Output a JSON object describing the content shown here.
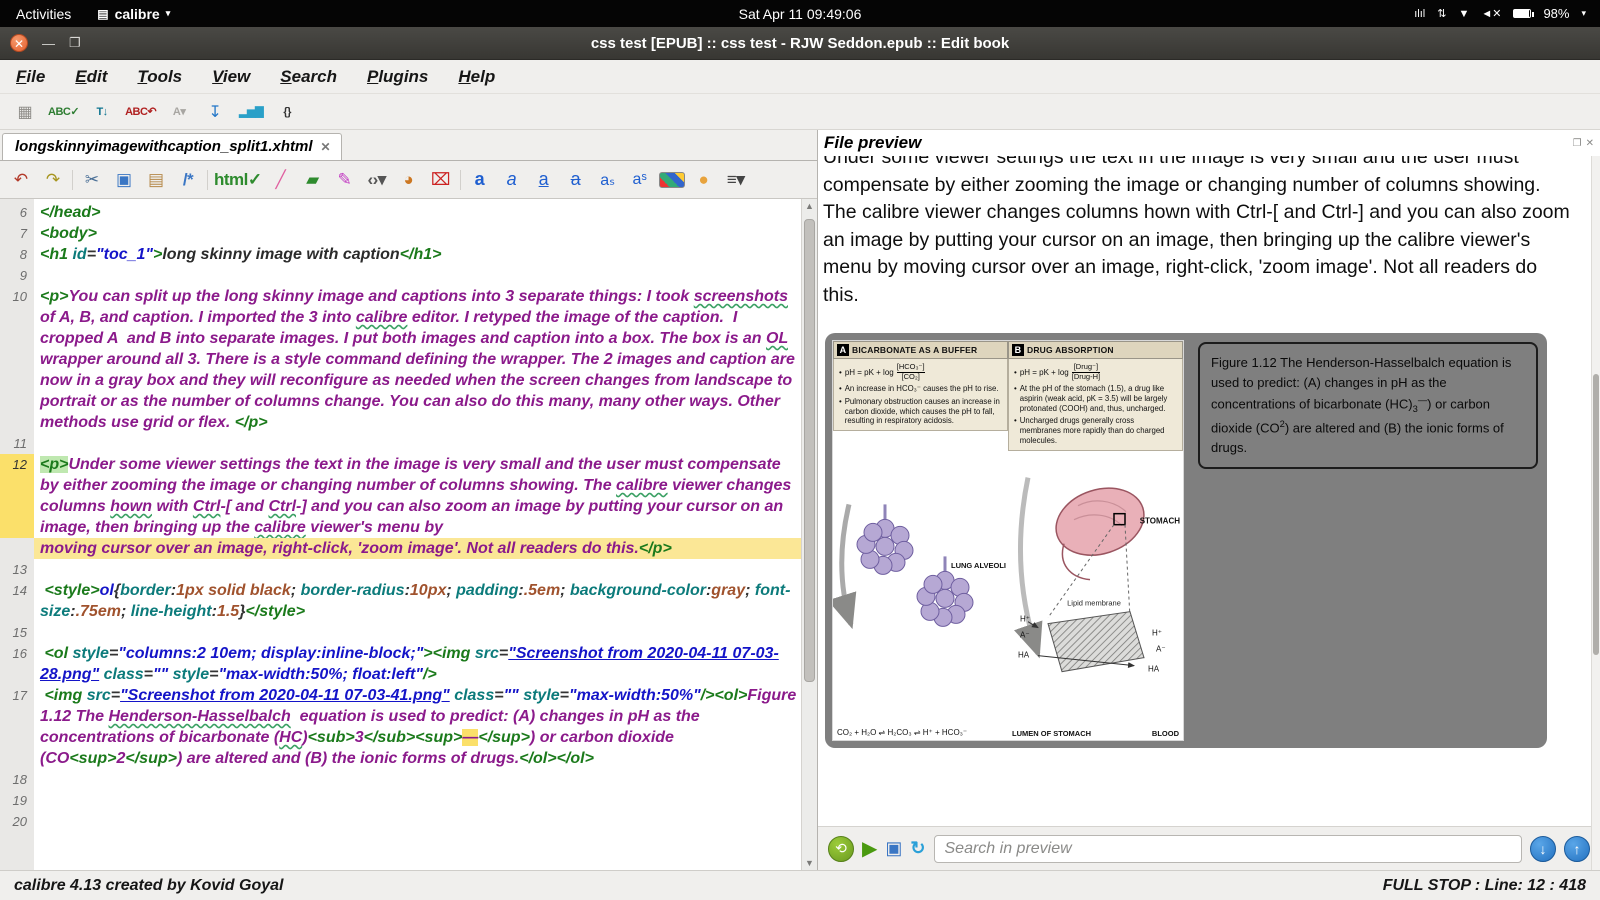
{
  "top_bar": {
    "activities": "Activities",
    "app_name": "calibre",
    "clock": "Sat Apr 11 09:49:06",
    "battery_pct": "98%",
    "tray": [
      {
        "name": "system-monitor-icon",
        "glyph": "ılıl"
      },
      {
        "name": "input-source-icon",
        "glyph": "⇅"
      },
      {
        "name": "network-icon",
        "glyph": "▼"
      },
      {
        "name": "volume-muted-icon",
        "glyph": "◄✕"
      }
    ]
  },
  "window": {
    "title": "css test [EPUB] :: css test - RJW Seddon.epub :: Edit book"
  },
  "menus": [
    "File",
    "Edit",
    "Tools",
    "View",
    "Search",
    "Plugins",
    "Help"
  ],
  "main_toolbar": [
    {
      "name": "grid-icon",
      "glyph": "▦",
      "color": "#8f8d89"
    },
    {
      "name": "spellcheck-icon",
      "glyph": "ABC✓",
      "txt": true,
      "color": "#2e7d32"
    },
    {
      "name": "text-down-arrow-icon",
      "glyph": "T↓",
      "txt": true,
      "color": "#0e7490"
    },
    {
      "name": "text-replace-icon",
      "glyph": "ABC↶",
      "txt": true,
      "color": "#b02020"
    },
    {
      "name": "letter-a-menu-icon",
      "glyph": "A▾",
      "txt": true,
      "color": "#a8a6a2"
    },
    {
      "name": "download-arrow-icon",
      "glyph": "↧",
      "color": "#2477c8"
    },
    {
      "name": "bar-chart-icon",
      "glyph": "▂▅▇",
      "txt": true,
      "color": "#2aa0c8"
    },
    {
      "name": "braces-icon",
      "glyph": "{}",
      "txt": true,
      "color": "#333333"
    }
  ],
  "editor": {
    "tab": {
      "label": "longskinnyimagewithcaption_split1.xhtml",
      "close_glyph": "✕"
    },
    "toolbar": [
      {
        "name": "undo-icon",
        "glyph": "↶",
        "color": "#b33a2a"
      },
      {
        "name": "redo-icon",
        "glyph": "↷",
        "color": "#a7951f"
      },
      {
        "sep": true
      },
      {
        "name": "cut-icon",
        "glyph": "✂",
        "color": "#4a6f96"
      },
      {
        "name": "copy-icon",
        "glyph": "▣",
        "color": "#3a76c4"
      },
      {
        "name": "paste-icon",
        "glyph": "▤",
        "color": "#b5894a"
      },
      {
        "name": "comment-icon",
        "glyph": "/*",
        "txt": true,
        "color": "#3a76c4"
      },
      {
        "sep": true
      },
      {
        "name": "html-check-icon",
        "glyph": "html✓",
        "txt": true,
        "color": "#2e8b2e"
      },
      {
        "name": "pink-slash-icon",
        "glyph": "╱",
        "color": "#e060a0"
      },
      {
        "name": "green-book-icon",
        "glyph": "▰",
        "color": "#2e8b2e"
      },
      {
        "name": "beautify-pen-icon",
        "glyph": "✎",
        "color": "#c23ac2"
      },
      {
        "name": "code-tags-icon",
        "glyph": "‹›▾",
        "txt": true,
        "color": "#555555"
      },
      {
        "name": "color-wheel-icon",
        "glyph": "◕",
        "color": "#cc7722"
      },
      {
        "name": "trash-icon",
        "glyph": "⌧",
        "color": "#cc2222"
      },
      {
        "sep": true
      },
      {
        "name": "bold-a-icon",
        "glyph": "a",
        "cls": "ab"
      },
      {
        "name": "italic-a-icon",
        "glyph": "a",
        "cls": "ai"
      },
      {
        "name": "underline-a-icon",
        "glyph": "a",
        "cls": "au"
      },
      {
        "name": "strikethrough-a-icon",
        "glyph": "a",
        "cls": "as"
      },
      {
        "name": "subscript-icon",
        "glyph": "aₛ",
        "cls": "asub"
      },
      {
        "name": "superscript-icon",
        "glyph": "aˢ",
        "cls": "asup"
      },
      {
        "name": "text-color-icon",
        "swatch": true
      },
      {
        "name": "background-color-icon",
        "glyph": "●",
        "color": "#e8a33d"
      },
      {
        "name": "align-menu-icon",
        "glyph": "≡▾",
        "txt": true,
        "color": "#444444"
      }
    ],
    "lines": [
      {
        "num": "6",
        "seg": [
          {
            "t": "</head>",
            "c": "g"
          }
        ]
      },
      {
        "num": "7",
        "seg": [
          {
            "t": "<body>",
            "c": "g"
          }
        ]
      },
      {
        "num": "8",
        "seg": [
          {
            "t": "<h1 ",
            "c": "g"
          },
          {
            "t": "id",
            "c": "a"
          },
          {
            "t": "=",
            "c": "pl"
          },
          {
            "t": "\"toc_1\"",
            "c": "v"
          },
          {
            "t": ">",
            "c": "g"
          },
          {
            "t": "long skinny image with caption",
            "c": "h"
          },
          {
            "t": "</h1>",
            "c": "g"
          }
        ]
      },
      {
        "num": "9",
        "seg": []
      },
      {
        "num": "10",
        "seg": [
          {
            "t": "<p>",
            "c": "g"
          },
          {
            "t": "You can split up the long skinny image and captions into 3 separate things: I took ",
            "c": "tx"
          },
          {
            "t": "screenshots",
            "c": "tx u"
          },
          {
            "t": " of A, B, and caption. I imported the 3 into ",
            "c": "tx"
          },
          {
            "t": "calibre",
            "c": "tx u"
          },
          {
            "t": " editor. I retyped the image of the caption.  I cropped A  and B into separate images. I put both images and caption into a box. The box is an ",
            "c": "tx"
          },
          {
            "t": "OL",
            "c": "tx u"
          },
          {
            "t": " wrapper around all 3. There is a style command defining the wrapper. The 2 images and caption are now in a gray box and they will reconfigure as needed when the screen changes from landscape to portrait or as the number of columns change. You can also do this many, many other ways. Other methods use grid or flex. ",
            "c": "tx"
          },
          {
            "t": "</p>",
            "c": "g"
          }
        ]
      },
      {
        "num": "11",
        "seg": []
      },
      {
        "num": "12",
        "numHl": true,
        "seg": [
          {
            "t": "<p>",
            "c": "g hlG"
          },
          {
            "t": "Under some viewer settings the text in the image is very small and the user must compensate by either zooming the image or changing number of columns showing. The ",
            "c": "tx"
          },
          {
            "t": "calibre",
            "c": "tx u"
          },
          {
            "t": " viewer changes columns ",
            "c": "tx"
          },
          {
            "t": "hown",
            "c": "tx u"
          },
          {
            "t": " with ",
            "c": "tx"
          },
          {
            "t": "Ctrl",
            "c": "tx u"
          },
          {
            "t": "-[ and ",
            "c": "tx"
          },
          {
            "t": "Ctrl",
            "c": "tx u"
          },
          {
            "t": "-] and you can also zoom an image by putting your cursor on an image, then bringing up the ",
            "c": "tx"
          },
          {
            "t": "calibre",
            "c": "tx u"
          },
          {
            "t": " viewer's menu by",
            "c": "tx"
          }
        ]
      },
      {
        "num": "",
        "rowHl": true,
        "seg": [
          {
            "t": "moving cursor over an image, right-click, 'zoom image'. Not all readers do this.",
            "c": "tx"
          },
          {
            "t": "</p>",
            "c": "g"
          }
        ]
      },
      {
        "num": "13",
        "seg": []
      },
      {
        "num": "14",
        "seg": [
          {
            "t": " ",
            "c": "pl"
          },
          {
            "t": "<style>",
            "c": "g"
          },
          {
            "t": "ol",
            "c": "v"
          },
          {
            "t": "{",
            "c": "pl"
          },
          {
            "t": "border",
            "c": "cp"
          },
          {
            "t": ":",
            "c": "pl"
          },
          {
            "t": "1px solid black",
            "c": "cv"
          },
          {
            "t": "; ",
            "c": "pl"
          },
          {
            "t": "border-radius",
            "c": "cp"
          },
          {
            "t": ":",
            "c": "pl"
          },
          {
            "t": "10px",
            "c": "cv"
          },
          {
            "t": "; ",
            "c": "pl"
          },
          {
            "t": "padding",
            "c": "cp"
          },
          {
            "t": ":",
            "c": "pl"
          },
          {
            "t": ".5em",
            "c": "cv"
          },
          {
            "t": "; ",
            "c": "pl"
          },
          {
            "t": "background-color",
            "c": "cp"
          },
          {
            "t": ":",
            "c": "pl"
          },
          {
            "t": "gray",
            "c": "cv"
          },
          {
            "t": "; ",
            "c": "pl"
          },
          {
            "t": "font-size",
            "c": "cp"
          },
          {
            "t": ":",
            "c": "pl"
          },
          {
            "t": ".75em",
            "c": "cv"
          },
          {
            "t": "; ",
            "c": "pl"
          },
          {
            "t": "line-height",
            "c": "cp"
          },
          {
            "t": ":",
            "c": "pl"
          },
          {
            "t": "1.5",
            "c": "cv"
          },
          {
            "t": "}",
            "c": "pl"
          },
          {
            "t": "</style>",
            "c": "g"
          }
        ]
      },
      {
        "num": "15",
        "seg": []
      },
      {
        "num": "16",
        "seg": [
          {
            "t": " ",
            "c": "pl"
          },
          {
            "t": "<ol ",
            "c": "g"
          },
          {
            "t": "style",
            "c": "a"
          },
          {
            "t": "=",
            "c": "pl"
          },
          {
            "t": "\"columns:2 10em; display:inline-block;\"",
            "c": "v"
          },
          {
            "t": ">",
            "c": "g"
          },
          {
            "t": "<img ",
            "c": "g"
          },
          {
            "t": "src",
            "c": "a"
          },
          {
            "t": "=",
            "c": "pl"
          },
          {
            "t": "\"Screenshot from 2020-04-11 07-03-28.png\"",
            "c": "v u2"
          },
          {
            "t": " ",
            "c": "pl"
          },
          {
            "t": "class",
            "c": "a"
          },
          {
            "t": "=",
            "c": "pl"
          },
          {
            "t": "\"\"",
            "c": "v"
          },
          {
            "t": " ",
            "c": "pl"
          },
          {
            "t": "style",
            "c": "a"
          },
          {
            "t": "=",
            "c": "pl"
          },
          {
            "t": "\"max-width:50%; float:left\"",
            "c": "v"
          },
          {
            "t": "/>",
            "c": "g"
          }
        ]
      },
      {
        "num": "17",
        "seg": [
          {
            "t": " ",
            "c": "pl"
          },
          {
            "t": "<img ",
            "c": "g"
          },
          {
            "t": "src",
            "c": "a"
          },
          {
            "t": "=",
            "c": "pl"
          },
          {
            "t": "\"Screenshot from 2020-04-11 07-03-41.png\"",
            "c": "v u2"
          },
          {
            "t": " ",
            "c": "pl"
          },
          {
            "t": "class",
            "c": "a"
          },
          {
            "t": "=",
            "c": "pl"
          },
          {
            "t": "\"\"",
            "c": "v"
          },
          {
            "t": " ",
            "c": "pl"
          },
          {
            "t": "style",
            "c": "a"
          },
          {
            "t": "=",
            "c": "pl"
          },
          {
            "t": "\"max-width:50%\"",
            "c": "v"
          },
          {
            "t": "/>",
            "c": "g"
          },
          {
            "t": "<ol>",
            "c": "g"
          },
          {
            "t": "Figure 1.12 The ",
            "c": "tx"
          },
          {
            "t": "Henderson-Hasselbalch",
            "c": "tx u"
          },
          {
            "t": "  equation is used to predict: (A) changes in pH as the concentrations of bicarbonate (",
            "c": "tx"
          },
          {
            "t": "HC",
            "c": "tx u"
          },
          {
            "t": ")",
            "c": "tx"
          },
          {
            "t": "<sub>",
            "c": "g"
          },
          {
            "t": "3",
            "c": "tx"
          },
          {
            "t": "</sub>",
            "c": "g"
          },
          {
            "t": "<sup>",
            "c": "g"
          },
          {
            "t": "—",
            "c": "tx hlY"
          },
          {
            "t": "</sup>",
            "c": "g"
          },
          {
            "t": ") or carbon dioxide (CO",
            "c": "tx"
          },
          {
            "t": "<sup>",
            "c": "g"
          },
          {
            "t": "2",
            "c": "tx"
          },
          {
            "t": "</sup>",
            "c": "g"
          },
          {
            "t": ") are altered and (B) the ionic forms of drugs.",
            "c": "tx"
          },
          {
            "t": "</ol>",
            "c": "g"
          },
          {
            "t": "</ol>",
            "c": "g"
          }
        ]
      },
      {
        "num": "18",
        "seg": []
      },
      {
        "num": "19",
        "seg": []
      },
      {
        "num": "20",
        "seg": []
      }
    ]
  },
  "preview": {
    "title": "File preview",
    "panel_icons": [
      "❐",
      "✕"
    ],
    "doc_paragraph": "Under some viewer settings the text in the image is very small and the user must compensate by either zooming the image or changing number of columns showing. The calibre viewer changes columns hown with Ctrl-[ and Ctrl-] and you can also zoom an image by putting your cursor on an image, then bringing up the calibre viewer's menu by moving cursor over an image, right-click, 'zoom image'. Not all readers do this.",
    "search_placeholder": "Search in preview",
    "figure": {
      "panelA": {
        "tag": "A",
        "title": "BICARBONATE AS A  BUFFER",
        "formula_lead": "pH = pK + log",
        "frac_num": "[HCO₃⁻]",
        "frac_den": "[CO₂]",
        "bullets": [
          "An increase in HCO₃⁻ causes the pH to rise.",
          "Pulmonary obstruction causes an increase in carbon dioxide, which causes the pH to fall, resulting in respiratory acidosis."
        ],
        "label": "LUNG ALVEOLI",
        "equation": "CO₂ + H₂O ⇌ H₂CO₃ ⇌ H⁺ + HCO₃⁻"
      },
      "panelB": {
        "tag": "B",
        "title": "DRUG ABSORPTION",
        "formula_lead": "pH = pK + log",
        "frac_num": "[Drug⁻]",
        "frac_den": "[Drug-H]",
        "bullets": [
          "At the pH of the stomach (1.5), a drug like aspirin (weak acid, pK = 3.5) will be largely protonated (COOH) and, thus, uncharged.",
          "Uncharged drugs generally cross membranes more rapidly than do charged molecules."
        ],
        "stomach_label": "STOMACH",
        "membrane_label": "Lipid membrane",
        "membrane_marks": [
          "H⁺",
          "A⁻",
          "HA",
          "H⁺",
          "A⁻",
          "HA"
        ],
        "bottom_left": "LUMEN OF STOMACH",
        "bottom_right": "BLOOD"
      },
      "caption": {
        "segments": [
          {
            "t": "Figure 1.12 The Henderson-Hasselbalch equation is used to predict: (A) changes in pH as the concentrations of bicarbonate (HC)"
          },
          {
            "t": "3",
            "sub": true
          },
          {
            "t": "—",
            "sup": true
          },
          {
            "t": ") or carbon dioxide (CO"
          },
          {
            "t": "2",
            "sup": true
          },
          {
            "t": ") are altered and (B) the ionic forms of drugs."
          }
        ]
      }
    }
  },
  "status_bar": {
    "left": "calibre 4.13 created by Kovid Goyal",
    "right": "FULL STOP : Line: 12 : 418"
  }
}
